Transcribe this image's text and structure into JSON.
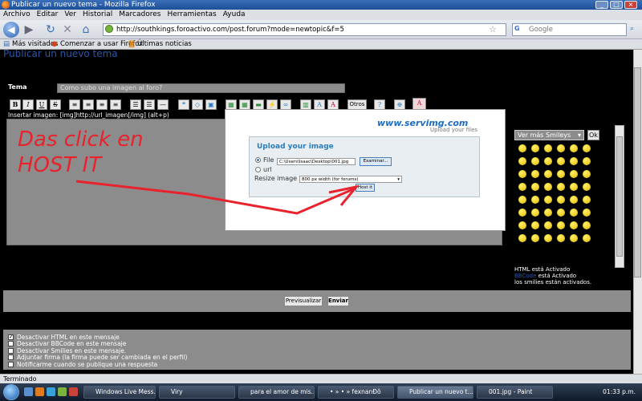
{
  "window": {
    "title": "Publicar un nuevo tema - Mozilla Firefox"
  },
  "menu": [
    "Archivo",
    "Editar",
    "Ver",
    "Historial",
    "Marcadores",
    "Herramientas",
    "Ayuda"
  ],
  "nav": {
    "url": "http://southkings.foroactivo.com/post.forum?mode=newtopic&f=5",
    "search_placeholder": "Google"
  },
  "bookmarks": [
    "Más visitados",
    "Comenzar a usar Firefox",
    "Últimas noticias"
  ],
  "page": {
    "heading": "Publicar un nuevo tema",
    "subject_label": "Tema",
    "subject_value": "Como subo una imagen al foro?",
    "format_buttons": [
      "B",
      "I",
      "U",
      "S"
    ],
    "others_label": "Otros",
    "insert_image_hint": "Insertar imagen: [img]http://url_imagen[/img] (alt+p)",
    "annotation_line1": "Das click en",
    "annotation_line2": "HOST IT"
  },
  "servimg": {
    "logo": "www.servimg.com",
    "tagline": "Upload your files",
    "title": "Upload your image",
    "file_label": "File",
    "file_value": "C:\\Users\\Isaac\\Desktop\\001.jpg",
    "browse_label": "Examinar...",
    "url_label": "url",
    "resize_label": "Resize image",
    "resize_value": "800 px width (for forums)",
    "host_button": "Host it"
  },
  "smileys": {
    "select_label": "Ver más Smileys",
    "ok_label": "Ok",
    "status_html_a": "HTML",
    "status_html_b": " está Activado",
    "status_bbcode_a": "BBCode",
    "status_bbcode_b": " está Activado",
    "status_smilies": "los smilies están activados."
  },
  "actions": {
    "preview": "Previsualizar",
    "send": "Enviar"
  },
  "options": [
    {
      "label": "Desactivar HTML en este mensaje",
      "checked": true
    },
    {
      "label": "Desactivar BBCode en este mensaje",
      "checked": false
    },
    {
      "label": "Desactivar Smilies en este mensaje.",
      "checked": false
    },
    {
      "label": "Adjuntar firma (la firma puede ser cambiada en el perfil)",
      "checked": false
    },
    {
      "label": "Notificarme cuando se publique una respuesta",
      "checked": false
    }
  ],
  "status": "Terminado",
  "taskbar": {
    "tasks": [
      "Windows Live Mess...",
      "Viry",
      "para el amor de mis...",
      "• » • » fexnanÐô",
      "Publicar un nuevo t...",
      "001.jpg - Paint"
    ],
    "clock": "01:33 p.m."
  },
  "colors": {
    "annotation": "#e8232d",
    "servimg_blue": "#2a7cc0",
    "link_blue": "#2c55a8"
  }
}
